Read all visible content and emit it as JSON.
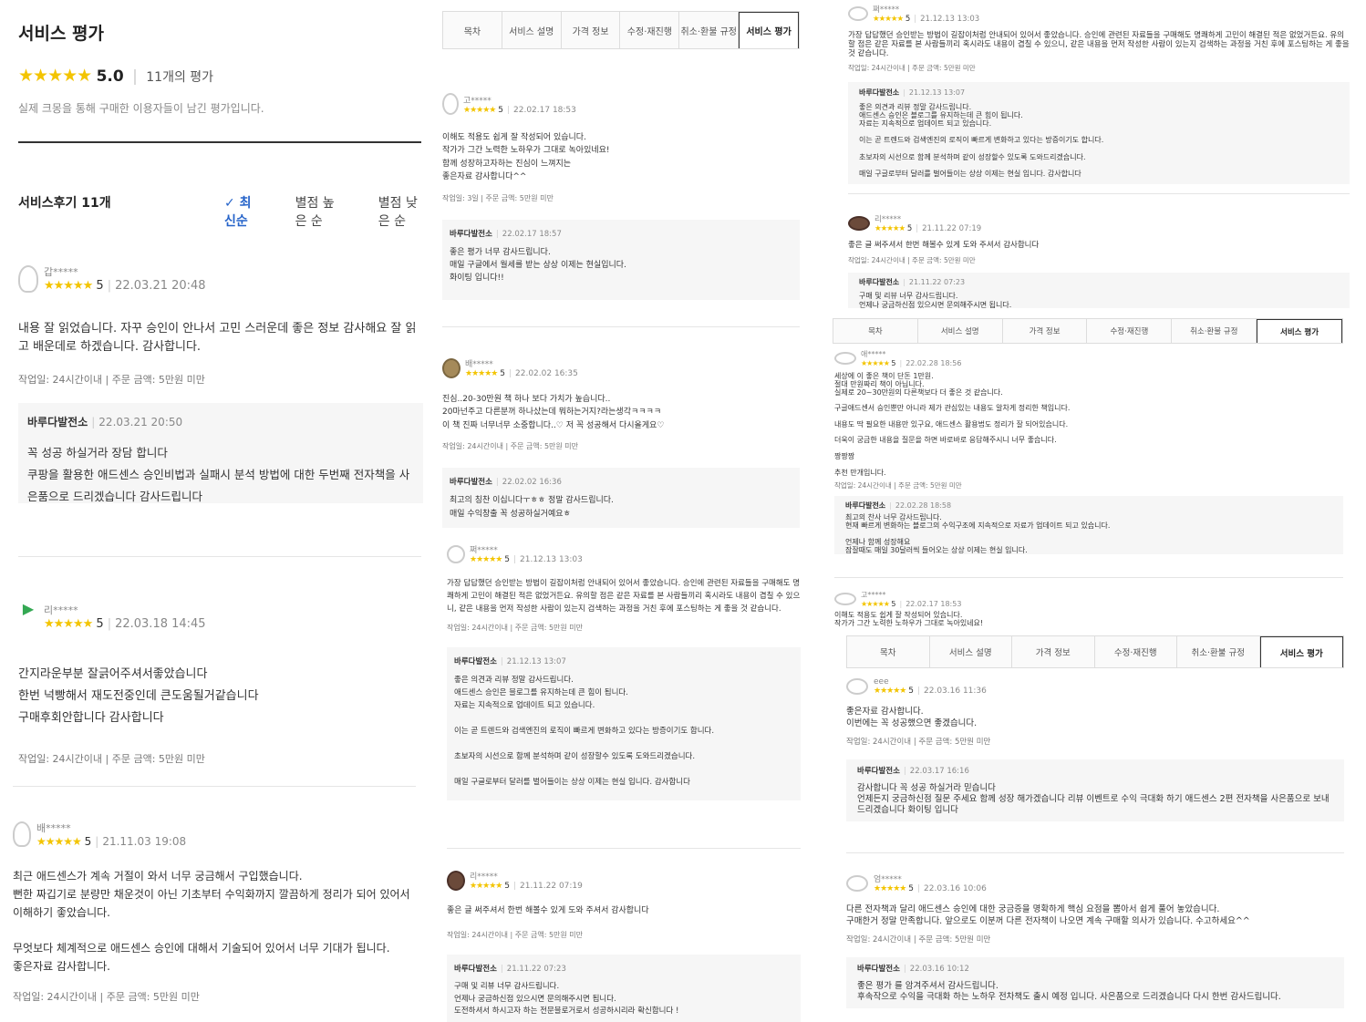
{
  "p1": {
    "title": "서비스 평가",
    "stars": "★★★★★",
    "rating": "5.0",
    "rating_count": "11개의 평가",
    "subtitle": "실제 크몽을 통해 구매한 이용자들이 남긴 평가입니다.",
    "list_title": "서비스후기 11개",
    "sort": [
      "✓ 최신순",
      "별점 높은 순",
      "별점 낮은 순"
    ],
    "reviews": [
      {
        "user": "갑*****",
        "score": "5",
        "date": "22.03.21 20:48",
        "text": "내용 잘 읽었습니다. 자꾸 승인이 안나서 고민 스러운데 좋은 정보 감사해요 잘 읽고 배운데로 하겠습니다. 감사합니다.",
        "meta": "작업일: 24시간이내 | 주문 금액: 5만원 미만",
        "reply_name": "바루다발전소",
        "reply_date": "22.03.21 20:50",
        "reply_text": "꼭 성공 하실거라 장담 합니다\n쿠팡을 활용한 애드센스 승인비법과 실패시 분석 방법에 대한 두번째 전자책을 사은품으로 드리겠습니다 감사드립니다"
      },
      {
        "user": "리*****",
        "score": "5",
        "date": "22.03.18 14:45",
        "text": "간지라운부분 잘긁어주셔서좋았습니다\n한번 넉빵해서 재도전중인데 큰도움될거같습니다\n구매후회안합니다 감사합니다",
        "meta": "작업일: 24시간이내 | 주문 금액: 5만원 미만"
      },
      {
        "user": "배*****",
        "score": "5",
        "date": "21.11.03 19:08",
        "text": "최근 애드센스가 계속 거절이 와서 너무 궁금해서 구입했습니다.\n뻔한 짜깁기로 분량만 채운것이 아닌 기초부터 수익화까지 깔끔하게 정리가 되어 있어서\n이해하기 좋았습니다.\n\n무엇보다 체계적으로 애드센스 승인에 대해서 기술되어 있어서 너무 기대가 됩니다.\n좋은자료 감사합니다.",
        "meta": "작업일: 24시간이내 | 주문 금액: 5만원 미만"
      }
    ]
  },
  "p2": {
    "tabs": [
      "목차",
      "서비스 설명",
      "가격 정보",
      "수정·재진행",
      "취소·환불 규정",
      "서비스 평가"
    ],
    "reviews": [
      {
        "user": "고*****",
        "score": "5",
        "date": "22.02.17 18:53",
        "text": "이해도 적용도 쉽게 잘 작성되어 있습니다.\n작가가 그간 노력한 노하우가 그대로 녹아있네요!\n함께 성장하고자하는 진심이 느껴지는\n좋은자료 감사합니다^^",
        "meta": "작업일: 3일 | 주문 금액: 5만원 미만",
        "reply_name": "바루다발전소",
        "reply_date": "22.02.17 18:57",
        "reply_text": "좋은 평가 너무 감사드립니다.\n매일 구글에서 월세를 받는 상상 이제는 현실입니다.\n화이팅 입니다!!"
      },
      {
        "user": "배*****",
        "score": "5",
        "date": "22.02.02 16:35",
        "text": "진심..20-30만원 책 하나 보다 가치가 높습니다..\n20마넌주고 다른분꺼 하나샀는데 뭐하는거지?라는생각ㅋㅋㅋㅋ\n이 책 진짜 너무너무 소중합니다..♡ 저 꼭 성공해서 다시올게요♡",
        "meta": "작업일: 24시간이내 | 주문 금액: 5만원 미만",
        "reply_name": "바루다발전소",
        "reply_date": "22.02.02 16:36",
        "reply_text": "최고의 칭찬 이십니다ㅜㅎㅎ 정말 감사드립니다.\n매일 수익창출 꼭 성공하실거예요ㅎ"
      },
      {
        "user": "쩌*****",
        "score": "5",
        "date": "21.12.13 13:03",
        "text": "가장 답답했던 승인받는 방법이 길잡이처럼 안내되어 있어서 좋았습니다. 승인에 관련된 자료들을 구매해도 명쾌하게 고민이 해결된 적은 없었거든요. 유의할 점은 같은 자료를 본 사람들끼리 혹시라도 내용이 겹칠 수 있으니, 같은 내용을 먼저 작성한 사람이 있는지 검색하는 과정을 거친 후에 포스팅하는 게 좋을 것 같습니다.",
        "meta": "작업일: 24시간이내 | 주문 금액: 5만원 미만",
        "reply_name": "바루다발전소",
        "reply_date": "21.12.13 13:07",
        "reply_text": "좋은 의견과 리뷰 정말 감사드립니다.\n애드센스 승인은 블로그를 유지하는데 큰 힘이 됩니다.\n자료는 지속적으로 업데이트 되고 있습니다.\n\n이는 곧 트렌드와 검색엔진의 로직이 빠르게 변화하고 있다는 방증이기도 합니다.\n\n초보자의 시선으로 함께 분석하며 같이 성장할수 있도록 도와드리겠습니다.\n\n매일 구글로부터 달러를 벌어들이는 상상 이제는 현실 입니다. 감사합니다"
      },
      {
        "user": "리*****",
        "score": "5",
        "date": "21.11.22 07:19",
        "text": "좋은 글 써주셔서 한번 해볼수 있게 도와 주셔서 감사합니다",
        "meta": "작업일: 24시간이내 | 주문 금액: 5만원 미만",
        "reply_name": "바루다발전소",
        "reply_date": "21.11.22 07:23",
        "reply_text": "구매 및 리뷰 너무 감사드립니다.\n언제나 궁금하신점 있으시면 문의해주시면 됩니다.\n도전하셔서 하시고자 하는 전문블로거로서 성공하시리라 확신합니다 !"
      }
    ]
  },
  "p3": {
    "reviews": [
      {
        "user": "쩌*****",
        "score": "5",
        "date": "21.12.13 13:03",
        "text": "가장 답답했던 승인받는 방법이 길잡이처럼 안내되어 있어서 좋았습니다. 승인에 관련된 자료들을 구매해도 명쾌하게 고민이 해결된 적은 없었거든요. 유의할 점은 같은 자료를 본 사람들끼리 혹시라도 내용이 겹칠 수 있으니, 같은 내용을 먼저 작성한 사람이 있는지 검색하는 과정을 거친 후에 포스팅하는 게 좋을 것 같습니다.",
        "meta": "작업일: 24시간이내 | 주문 금액: 5만원 미만",
        "reply_name": "바루다발전소",
        "reply_date": "21.12.13 13:07",
        "reply_text": "좋은 의견과 리뷰 정말 감사드립니다.\n애드센스 승인은 블로그를 유지하는데 큰 힘이 됩니다.\n자료는 지속적으로 업데이트 되고 있습니다.\n\n이는 곧 트렌드와 검색엔진의 로직이 빠르게 변화하고 있다는 방증이기도 합니다.\n\n초보자의 시선으로 함께 분석하며 같이 성장할수 있도록 도와드리겠습니다.\n\n매일 구글로부터 달러를 벌어들이는 상상 이제는 현실 입니다. 감사합니다"
      },
      {
        "user": "리*****",
        "score": "5",
        "date": "21.11.22 07:19",
        "text": "좋은 글 써주셔서 한번 해볼수 있게 도와 주셔서 감사합니다",
        "meta": "작업일: 24시간이내 | 주문 금액: 5만원 미만",
        "reply_name": "바루다발전소",
        "reply_date": "21.11.22 07:23",
        "reply_text": "구매 및 리뷰 너무 감사드립니다.\n언제나 궁금하신점 있으시면 문의해주시면 됩니다."
      }
    ]
  },
  "p4": {
    "tabs": [
      "목차",
      "서비스 설명",
      "가격 정보",
      "수정·재진행",
      "취소·환불 규정",
      "서비스 평가"
    ],
    "review": {
      "user": "애*****",
      "score": "5",
      "date": "22.02.28 18:56",
      "text": "세상에 이 좋은 책이 단돈 1만원.\n절대 만원짜리 책이 아닙니다.\n실제로 20~30만원의 다른책보다 더 좋은 것 같습니다.\n\n구글애드센서 승인뿐만 아니라 제가 관심있는 내용도 알차게 정리한 책입니다.\n\n내용도 딱 필요한 내용만 있구요, 애드센스 활용법도 정리가 잘 되어있습니다.\n\n더욱이 궁금한 내용을 질문을 하면 바로바로 응답해주시니 너무 좋습니다.\n\n짱짱짱\n\n추천 만개입니다.",
      "meta": "작업일: 24시간이내 | 주문 금액: 5만원 미만",
      "reply_name": "바루다발전소",
      "reply_date": "22.02.28 18:58",
      "reply_text": "최고의 찬사 너무 감사드립니다.\n현재 빠르게 변화하는 블로그의 수익구조에 지속적으로 자료가 업데이트 되고 있습니다.\n\n언제나 함께 성장해요\n잠잘때도 매일 30달러씩 들어오는 상상 이제는 현실 입니다."
    },
    "review2": {
      "user": "고*****",
      "score": "5",
      "date": "22.02.17 18:53",
      "text": "이해도 적용도 쉽게 잘 작성되어 있습니다.\n작가가 그간 노력한 노하우가 그대로 녹아있네요!"
    }
  },
  "p5": {
    "tabs": [
      "목차",
      "서비스 설명",
      "가격 정보",
      "수정·재진행",
      "취소·환불 규정",
      "서비스 평가"
    ],
    "reviews": [
      {
        "user": "eee",
        "score": "5",
        "date": "22.03.16 11:36",
        "text": "좋은자료 감사합니다.\n이번에는 꼭 성공했으면 좋겠습니다.",
        "meta": "작업일: 24시간이내 | 주문 금액: 5만원 미만",
        "reply_name": "바루다발전소",
        "reply_date": "22.03.17 16:16",
        "reply_text": "감사합니다 꼭 성공 하실거라 믿습니다\n언제든지 궁금하신점 질문 주세요 함께 성장 해가겠습니다 리뷰 이벤트로 수익 극대화 하기 애드센스 2편 전자책을 사은품으로 보내드리겠습니다 화이팅 입니다"
      },
      {
        "user": "엄*****",
        "score": "5",
        "date": "22.03.16 10:06",
        "text": "다른 전자책과 달리 애드센스 승인에 대한 궁금증을  명확하게 핵심 요점을 뽑아서 쉽게 풀어 놓았습니다.\n구매한거 정말 만족합니다. 앞으로도 이분꺼 다른 전자책이 나오면 계속 구매할 의사가 있습니다. 수고하세요^^",
        "meta": "작업일: 24시간이내 | 주문 금액: 5만원 미만",
        "reply_name": "바루다발전소",
        "reply_date": "22.03.16 10:12",
        "reply_text": "좋은 평가 를 암겨주셔서 감사드립니다.\n후속작으로 수익을 극대화 하는 노하우 전차책도 출시 예정 입니다. 사은품으로 드리겠습니다 다시 한번 감사드립니다."
      }
    ]
  }
}
